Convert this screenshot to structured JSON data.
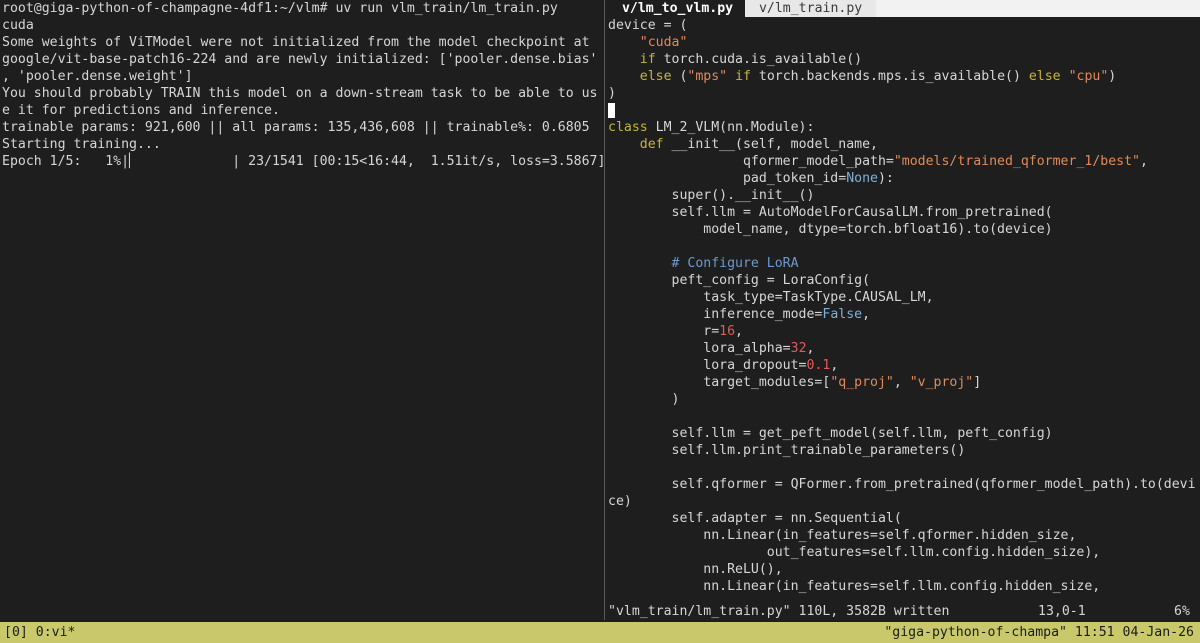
{
  "left_terminal": {
    "lines": [
      "root@giga-python-of-champagne-4df1:~/vlm# uv run vlm_train/lm_train.py",
      "cuda",
      "Some weights of ViTModel were not initialized from the model checkpoint at",
      "google/vit-base-patch16-224 and are newly initialized: ['pooler.dense.bias'",
      ", 'pooler.dense.weight']",
      "You should probably TRAIN this model on a down-stream task to be able to us",
      "e it for predictions and inference.",
      "trainable params: 921,600 || all params: 135,436,608 || trainable%: 0.6805",
      "Starting training...",
      "Epoch 1/5:   1%|▏            | 23/1541 [00:15<16:44,  1.51it/s, loss=3.5867]"
    ]
  },
  "editor": {
    "tabs": [
      {
        "label": " v/lm_to_vlm.py ",
        "active": true
      },
      {
        "label": " v/lm_train.py ",
        "active": false
      }
    ],
    "lines": [
      "device = (",
      "    \"cuda\"",
      "    if torch.cuda.is_available()",
      "    else (\"mps\" if torch.backends.mps.is_available() else \"cpu\")",
      ")",
      "",
      "class LM_2_VLM(nn.Module):",
      "    def __init__(self, model_name,",
      "                 qformer_model_path=\"models/trained_qformer_1/best\",",
      "                 pad_token_id=None):",
      "        super().__init__()",
      "        self.llm = AutoModelForCausalLM.from_pretrained(",
      "            model_name, dtype=torch.bfloat16).to(device)",
      "",
      "        # Configure LoRA",
      "        peft_config = LoraConfig(",
      "            task_type=TaskType.CAUSAL_LM,",
      "            inference_mode=False,",
      "            r=16,",
      "            lora_alpha=32,",
      "            lora_dropout=0.1,",
      "            target_modules=[\"q_proj\", \"v_proj\"]",
      "        )",
      "",
      "        self.llm = get_peft_model(self.llm, peft_config)",
      "        self.llm.print_trainable_parameters()",
      "",
      "        self.qformer = QFormer.from_pretrained(qformer_model_path).to(devi",
      "ce)",
      "        self.adapter = nn.Sequential(",
      "            nn.Linear(in_features=self.qformer.hidden_size,",
      "                    out_features=self.llm.config.hidden_size),",
      "            nn.ReLU(),",
      "            nn.Linear(in_features=self.llm.config.hidden_size,"
    ],
    "status": {
      "message": "\"vlm_train/lm_train.py\" 110L, 3582B written",
      "position": "13,0-1",
      "percent": "6%"
    }
  },
  "tmux": {
    "left": "[0] 0:vi*",
    "right": "\"giga-python-of-champa\" 11:51 04-Jan-26"
  },
  "colors": {
    "background": "#1e1e1e",
    "string": "#e08a5a",
    "keyword": "#c6b43c",
    "number": "#e05a5a",
    "constant": "#7fb0d8",
    "comment": "#6a9ad0",
    "tmux_bar": "#c9c96c"
  }
}
